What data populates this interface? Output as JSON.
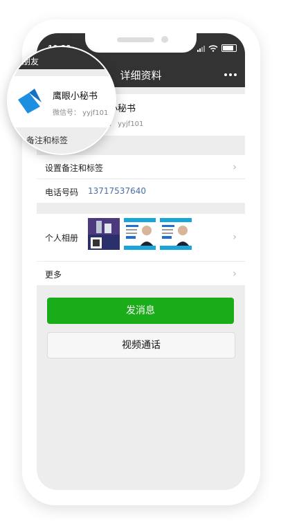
{
  "status": {
    "time": "10:36"
  },
  "nav": {
    "title": "详细资料",
    "back_fragment": "朋友"
  },
  "profile": {
    "name": "鹰眼小秘书",
    "wechat_id": "微信号： yyjf101",
    "name_partial": "小秘书",
    "wechat_partial": "：  yyjf101"
  },
  "section_label": "备注和标签",
  "rows": {
    "remark": "设置备注和标签",
    "phone_label": "电话号码",
    "phone_value": "13717537640",
    "album_label": "个人相册",
    "more_label": "更多"
  },
  "buttons": {
    "message": "发消息",
    "video_call": "视频通话"
  },
  "colors": {
    "primary_green": "#1aad19",
    "nav_dark": "#333333",
    "link_blue": "#4a6ea9"
  }
}
